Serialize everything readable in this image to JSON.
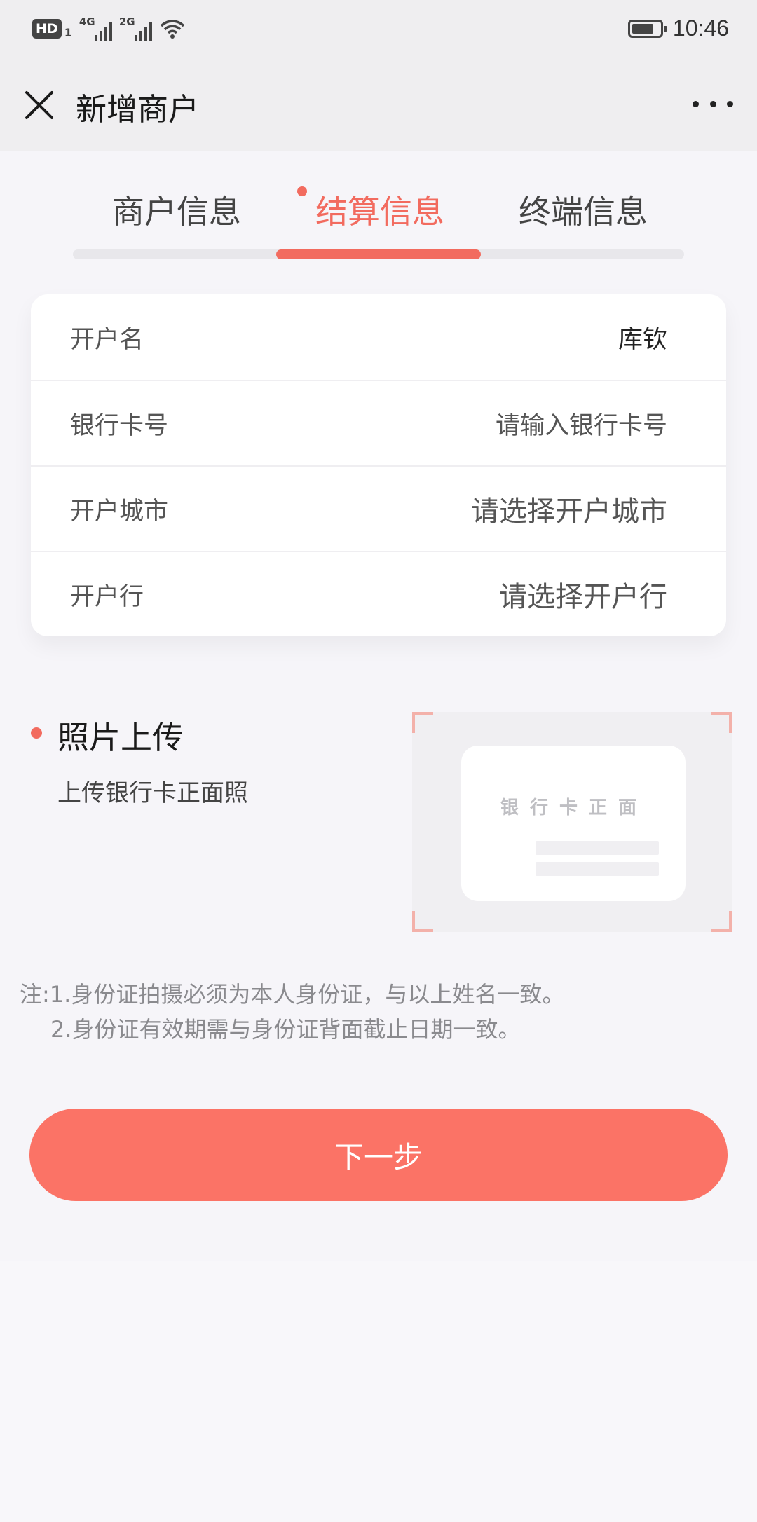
{
  "status_bar": {
    "hd_label": "HD",
    "hd_sub": "1",
    "network_1": "4G",
    "network_2": "2G",
    "time": "10:46"
  },
  "nav": {
    "title": "新增商户",
    "close_icon": "close-icon",
    "more_icon": "more-icon"
  },
  "tabs": [
    {
      "label": "商户信息",
      "active": false
    },
    {
      "label": "结算信息",
      "active": true
    },
    {
      "label": "终端信息",
      "active": false
    }
  ],
  "form": {
    "rows": [
      {
        "label": "开户名",
        "value": "库钦"
      },
      {
        "label": "银行卡号",
        "placeholder": "请输入银行卡号"
      },
      {
        "label": "开户城市",
        "placeholder": "请选择开户城市"
      },
      {
        "label": "开户行",
        "placeholder": "请选择开户行"
      }
    ]
  },
  "upload": {
    "title": "照片上传",
    "description": "上传银行卡正面照",
    "card_label": "银行卡正面"
  },
  "notes": {
    "line1": "注:1.身份证拍摄必须为本人身份证，与以上姓名一致。",
    "line2": "2.身份证有效期需与身份证背面截止日期一致。"
  },
  "next_button": "下一步",
  "colors": {
    "accent": "#f26b5f",
    "button": "#fb7366",
    "background": "#f6f5f9"
  }
}
